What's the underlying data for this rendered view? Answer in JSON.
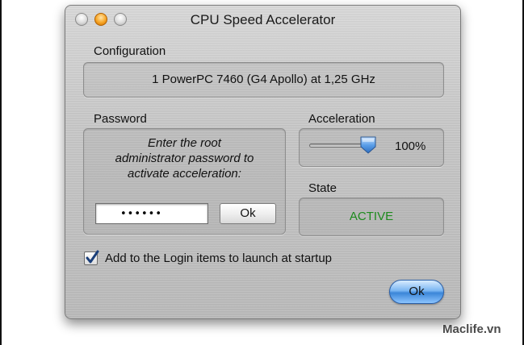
{
  "window": {
    "title": "CPU Speed Accelerator"
  },
  "configuration": {
    "label": "Configuration",
    "value": "1 PowerPC 7460 (G4 Apollo) at 1,25 GHz"
  },
  "password": {
    "label": "Password",
    "instructions_line1": "Enter the root",
    "instructions_line2": "administrator password to",
    "instructions_line3": "activate acceleration:",
    "masked_value": "••••••",
    "ok_label": "Ok"
  },
  "acceleration": {
    "label": "Acceleration",
    "level_percent": 100,
    "value_text": "100%"
  },
  "state": {
    "label": "State",
    "value": "ACTIVE",
    "value_color": "#1d8a1d"
  },
  "login_items": {
    "checked": true,
    "label": "Add to the Login items to launch at startup"
  },
  "footer": {
    "ok_label": "Ok"
  },
  "watermark": {
    "text": "Maclife.vn"
  },
  "colors": {
    "default_button": "#3b86d8",
    "window_close_button": "#f7a424"
  }
}
